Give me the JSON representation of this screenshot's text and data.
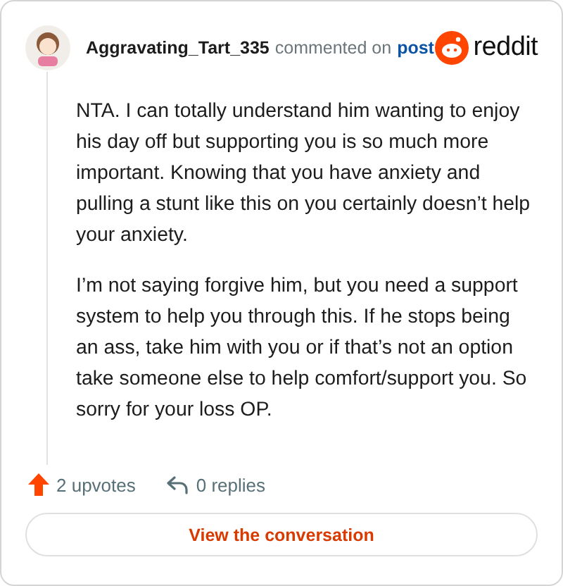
{
  "comment": {
    "author": "Aggravating_Tart_335",
    "action": "commented on",
    "link": "post",
    "brand": "reddit",
    "paragraphs": [
      "NTA. I can totally understand him wanting to enjoy his day off but supporting you is so much more important. Knowing that you have anxiety and pulling a stunt like this on you certainly doesn’t help your anxiety.",
      "I’m not saying forgive him, but you need a support system to help you through this. If he stops being an ass, take him with you or if that’s not an option take someone else to help comfort/support you. So sorry for your loss OP."
    ],
    "upvotes": "2 upvotes",
    "replies": "0 replies",
    "button": "View the conversation"
  }
}
